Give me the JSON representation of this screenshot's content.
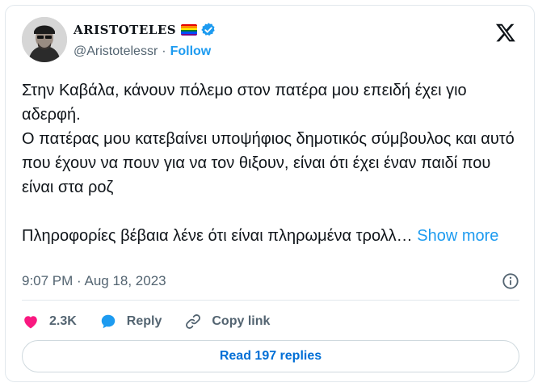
{
  "author": {
    "display_name": "ARISTOTELES",
    "handle": "@Aristotelessr",
    "separator": "·",
    "follow_label": "Follow"
  },
  "tweet": {
    "paragraphs": [
      "Στην Καβάλα, κάνουν πόλεμο στον πατέρα μου επειδή έχει γιο αδερφή.",
      "Ο πατέρας μου κατεβαίνει υποψήφιος δημοτικός σύμβουλος και αυτό που έχουν να πουν για να τον θιξουν, είναι ότι έχει έναν παιδί που είναι στα ροζ",
      "Πληροφορίες βέβαια λένε ότι είναι πληρωμένα τρολλ…"
    ],
    "show_more_label": "Show more",
    "timestamp": "9:07 PM · Aug 18, 2023"
  },
  "actions": {
    "likes_label": "2.3K",
    "reply_label": "Reply",
    "copy_link_label": "Copy link"
  },
  "read_replies_label": "Read 197 replies",
  "colors": {
    "accent": "#1d9bf0",
    "like": "#f91880",
    "text_secondary": "#536471",
    "border": "#e1e8ed"
  },
  "icons": {
    "brand": "x-logo-icon",
    "verified": "verified-badge-icon",
    "flag": "rainbow-flag-icon",
    "info": "info-icon",
    "like": "heart-icon",
    "reply": "speech-bubble-icon",
    "copy": "link-icon"
  }
}
